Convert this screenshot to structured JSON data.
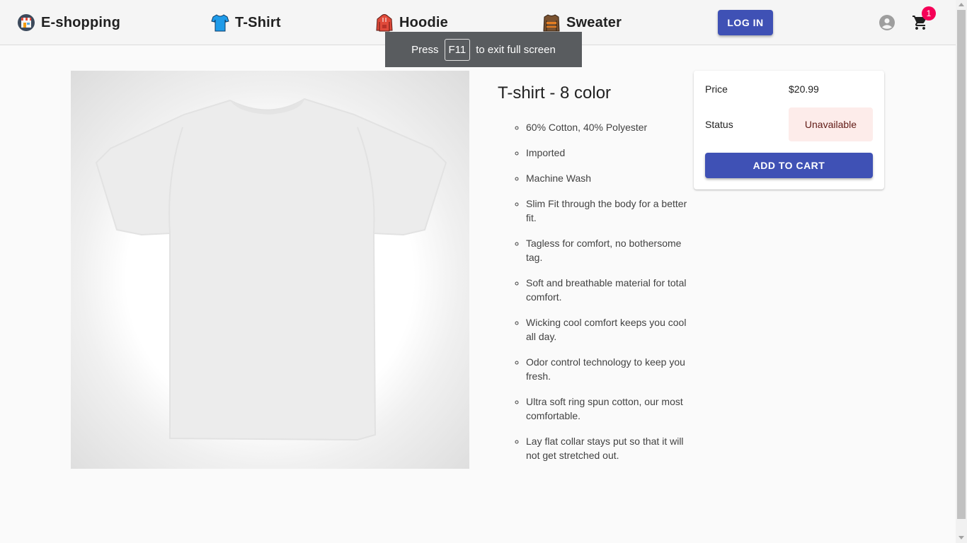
{
  "header": {
    "brand": "E-shopping",
    "nav": [
      {
        "label": "T-Shirt",
        "icon": "tshirt-icon"
      },
      {
        "label": "Hoodie",
        "icon": "hoodie-icon"
      },
      {
        "label": "Sweater",
        "icon": "sweater-icon"
      }
    ],
    "login_label": "LOG IN",
    "cart_count": "1"
  },
  "fullscreen_notice": {
    "prefix": "Press",
    "key": "F11",
    "suffix": "to exit full screen"
  },
  "product": {
    "title": "T-shirt - 8 color",
    "features": [
      "60% Cotton, 40% Polyester",
      "Imported",
      "Machine Wash",
      "Slim Fit through the body for a better fit.",
      "Tagless for comfort, no bothersome tag.",
      "Soft and breathable material for total comfort.",
      "Wicking cool comfort keeps you cool all day.",
      "Odor control technology to keep you fresh.",
      "Ultra soft ring spun cotton, our most comfortable.",
      "Lay flat collar stays put so that it will not get stretched out."
    ]
  },
  "card": {
    "price_label": "Price",
    "price": "$20.99",
    "status_label": "Status",
    "status": "Unavailable",
    "add_to_cart_label": "ADD TO CART"
  },
  "colors": {
    "primary": "#3f51b5",
    "badge": "#f50057",
    "status_bg": "#fdecea"
  }
}
